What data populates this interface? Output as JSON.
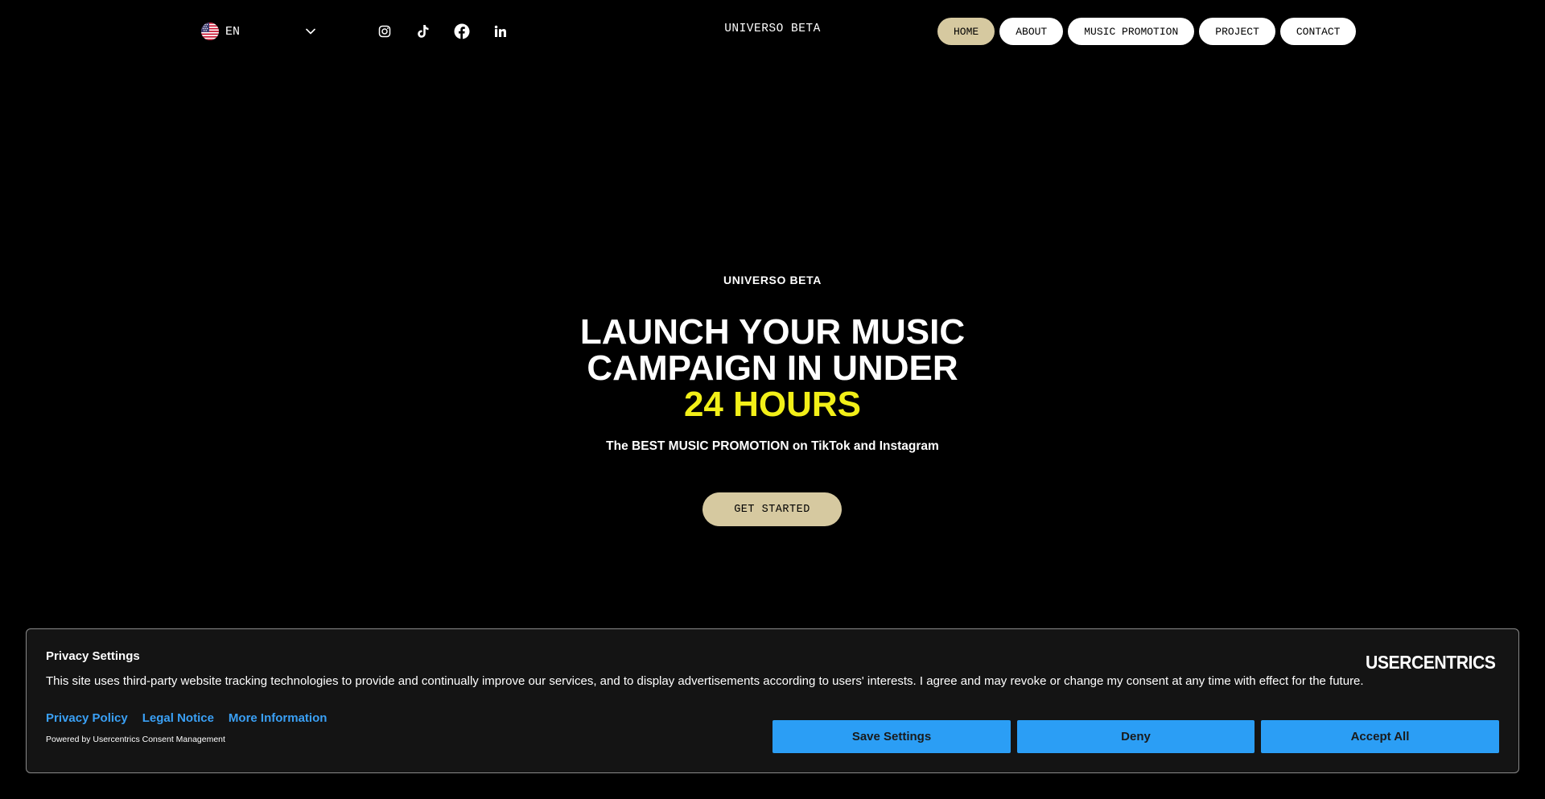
{
  "header": {
    "language": {
      "code": "EN",
      "flag_icon": "us-flag-icon"
    },
    "socials": [
      {
        "icon": "instagram-icon"
      },
      {
        "icon": "tiktok-icon"
      },
      {
        "icon": "facebook-icon"
      },
      {
        "icon": "linkedin-icon"
      }
    ],
    "brand": "UNIVERSO BETA",
    "nav": [
      {
        "label": "HOME",
        "active": true
      },
      {
        "label": "ABOUT"
      },
      {
        "label": "MUSIC PROMOTION"
      },
      {
        "label": "PROJECT"
      },
      {
        "label": "CONTACT"
      }
    ]
  },
  "hero": {
    "eyebrow": "UNIVERSO BETA",
    "headline_line1": "LAUNCH YOUR MUSIC",
    "headline_line2": "CAMPAIGN IN UNDER",
    "headline_highlight": "24 HOURS",
    "subline_prefix": "The ",
    "subline_bold": "BEST MUSIC PROMOTION",
    "subline_suffix": " on TikTok and Instagram",
    "cta_label": "GET STARTED"
  },
  "consent": {
    "title": "Privacy Settings",
    "text": "This site uses third-party website tracking technologies to provide and continually improve our services, and to display advertisements according to users' interests. I agree and may revoke or change my consent at any time with effect for the future.",
    "links": [
      "Privacy Policy",
      "Legal Notice",
      "More Information"
    ],
    "powered_by": "Powered by Usercentrics Consent Management",
    "logo_text": "USERCENTRICS",
    "buttons": {
      "save": "Save Settings",
      "deny": "Deny",
      "accept": "Accept All"
    }
  },
  "colors": {
    "background": "#000000",
    "accent_beige": "#d6c9a0",
    "highlight_yellow": "#f2ef18",
    "consent_blue": "#2b9ef5",
    "link_blue": "#3aa0f5"
  }
}
